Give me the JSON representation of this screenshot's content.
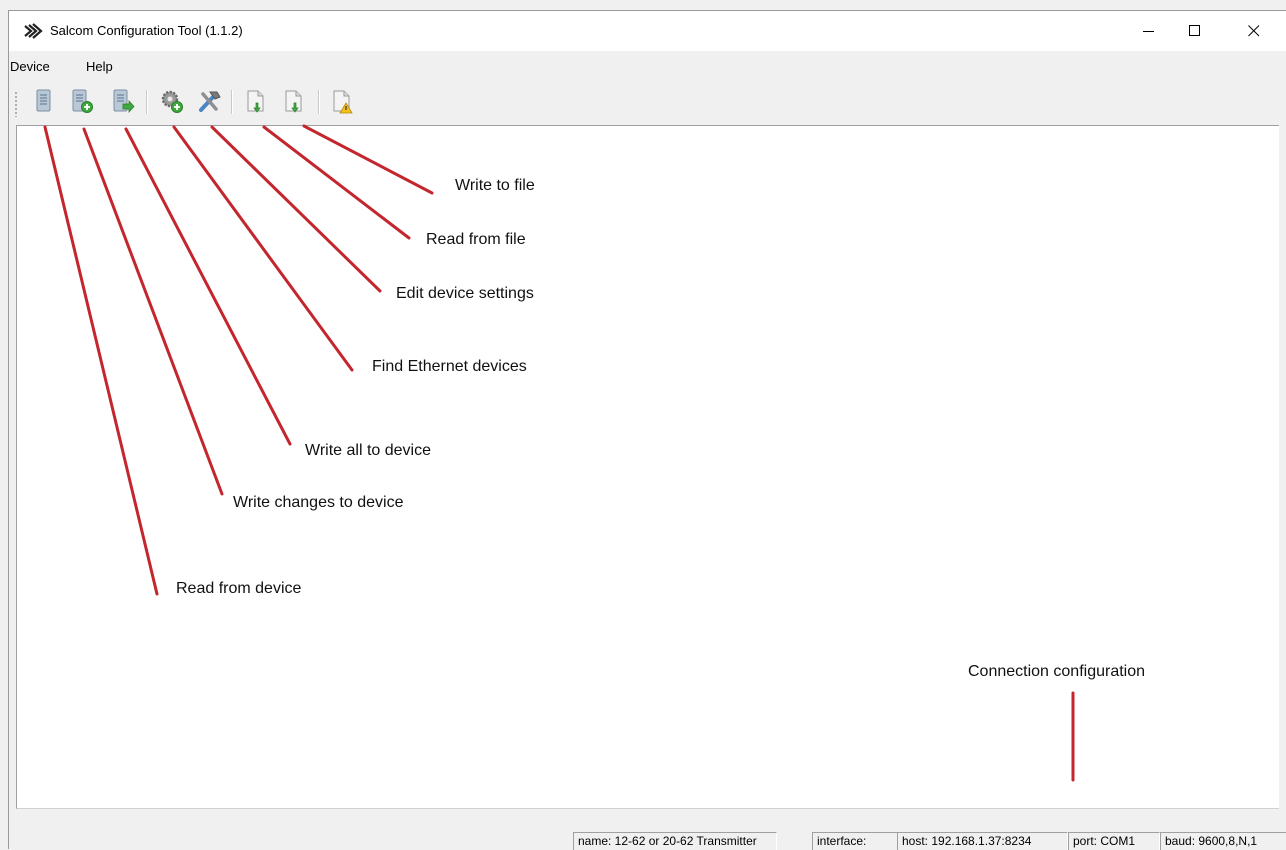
{
  "window": {
    "title": "Salcom Configuration Tool (1.1.2)",
    "controls": [
      "minimize-icon",
      "maximize-icon",
      "close-icon"
    ]
  },
  "menu": {
    "items": [
      {
        "label": "Device"
      },
      {
        "label": "Help"
      }
    ]
  },
  "toolbar": {
    "buttons": [
      {
        "icon": "device-read-icon",
        "tooltip": "Read from device"
      },
      {
        "icon": "device-write-changes-icon",
        "tooltip": "Write changes to device"
      },
      {
        "icon": "device-write-all-icon",
        "tooltip": "Write all to device"
      },
      {
        "icon": "gear-add-icon",
        "tooltip": "Find Ethernet devices"
      },
      {
        "icon": "tools-icon",
        "tooltip": "Edit device settings"
      },
      {
        "icon": "file-open-icon",
        "tooltip": "Read from file"
      },
      {
        "icon": "file-save-icon",
        "tooltip": "Write to file"
      },
      {
        "icon": "file-warning-icon",
        "tooltip": ""
      }
    ]
  },
  "annotations": {
    "write_to_file": "Write to file",
    "read_from_file": "Read from file",
    "edit_device_settings": "Edit device settings",
    "find_ethernet_devices": "Find Ethernet devices",
    "write_all_to_device": "Write all to device",
    "write_changes_to_device": "Write changes to device",
    "read_from_device": "Read from device",
    "connection_configuration": "Connection configuration",
    "line_color": "#c4262e"
  },
  "statusbar": {
    "name": "name: 12-62 or 20-62 Transmitter",
    "interface": "interface:",
    "host": "host: 192.168.1.37:8234",
    "port": "port: COM1",
    "baud": "baud: 9600,8,N,1"
  }
}
